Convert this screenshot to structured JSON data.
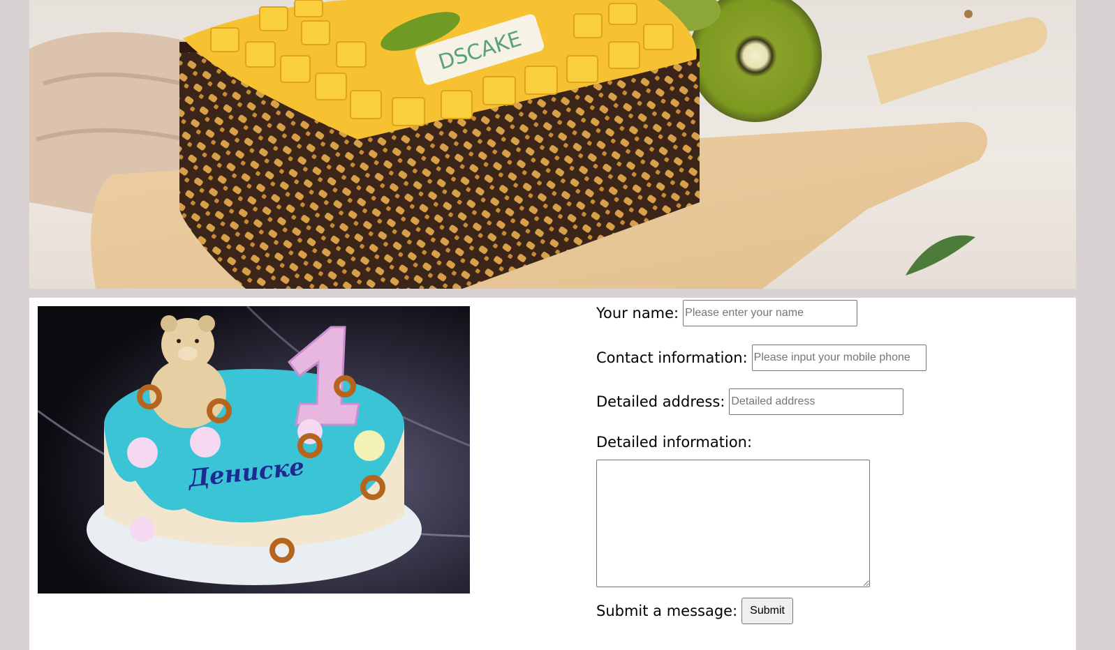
{
  "hero": {
    "image": "mango-cake-with-chocolate-lattice-on-cutting-board",
    "brand_plaque": "DSCAKE"
  },
  "cake_photo": {
    "image": "turquoise-birthday-cake-with-teddy-bear",
    "cake_writing": "Дениске"
  },
  "form": {
    "name_label": "Your name:",
    "name_placeholder": "Please enter your name",
    "contact_label": "Contact information:",
    "contact_placeholder": "Please input your mobile phone",
    "address_label": "Detailed address:",
    "address_placeholder": "Detailed address",
    "info_label": "Detailed information:",
    "submit_label": "Submit a message:",
    "submit_button": "Submit"
  }
}
